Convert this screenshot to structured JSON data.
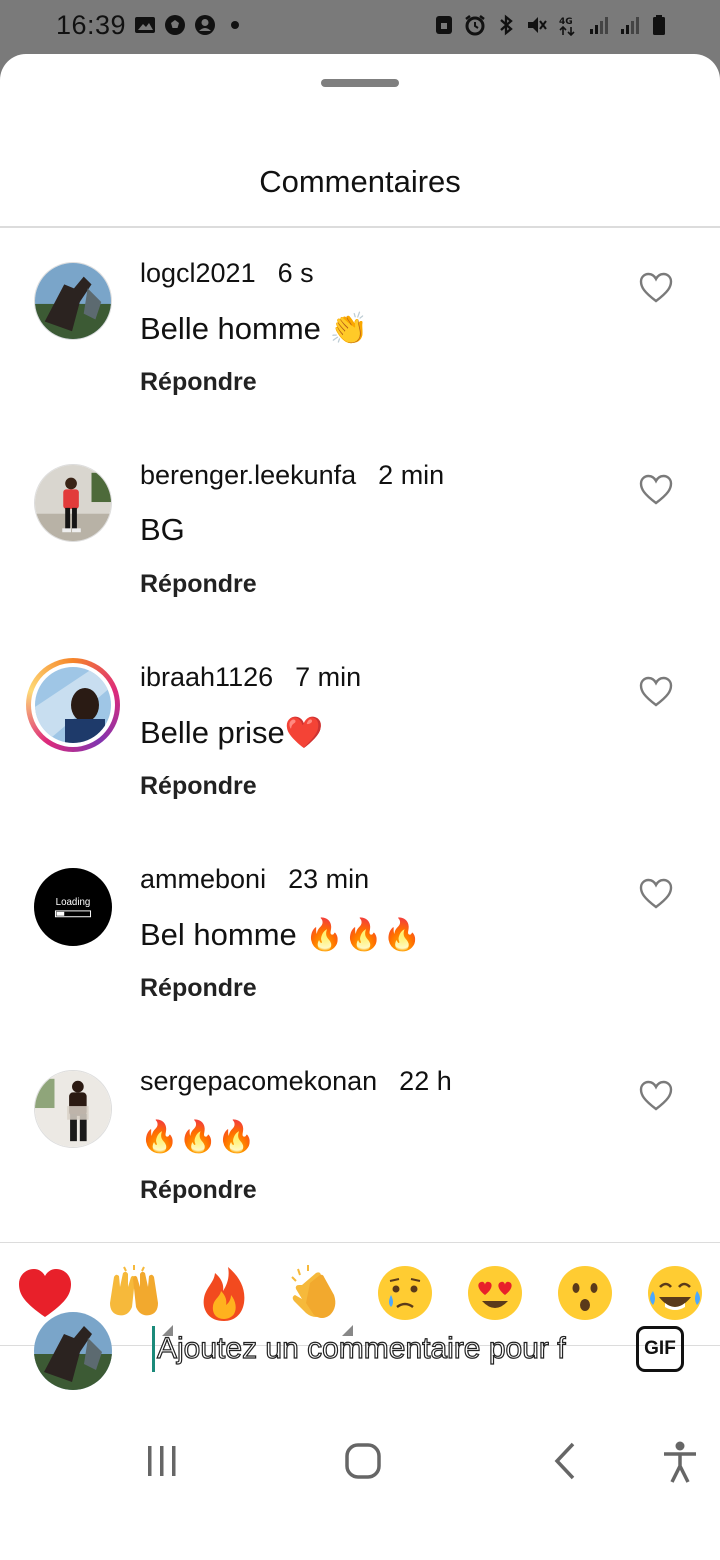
{
  "status_bar": {
    "time": "16:39",
    "left_icons": [
      "image-icon",
      "soccer-ball-icon",
      "account-circle-icon",
      "dot-icon"
    ],
    "right_icons": [
      "vpn-lock-icon",
      "alarm-icon",
      "bluetooth-icon",
      "mute-icon",
      "network-4g-icon",
      "signal-icon",
      "signal-icon",
      "battery-icon"
    ]
  },
  "sheet": {
    "title": "Commentaires"
  },
  "comments": [
    {
      "username": "logcl2021",
      "time": "6 s",
      "text": "Belle homme 👏",
      "reply_label": "Répondre",
      "avatar": "photo-hand"
    },
    {
      "username": "berenger.leekunfa",
      "time": "2 min",
      "text": "BG",
      "reply_label": "Répondre",
      "avatar": "photo-person-red"
    },
    {
      "username": "ibraah1126",
      "time": "7 min",
      "text": "Belle prise❤️",
      "reply_label": "Répondre",
      "avatar": "photo-story-ring"
    },
    {
      "username": "ammeboni",
      "time": "23 min",
      "text": "Bel homme 🔥🔥🔥",
      "reply_label": "Répondre",
      "avatar": "loading-logo"
    },
    {
      "username": "sergepacomekonan",
      "time": "22 h",
      "text": "🔥🔥🔥",
      "reply_label": "Répondre",
      "avatar": "photo-person-dark"
    }
  ],
  "loading_avatar_text": "Loading",
  "emoji_bar": {
    "items": [
      "red-heart",
      "raising-hands",
      "fire",
      "clapping-hands",
      "crying-face",
      "heart-eyes-face",
      "surprised-face",
      "tears-of-joy-face"
    ]
  },
  "composer": {
    "placeholder": "Ajoutez un commentaire pour f",
    "gif_label": "GIF"
  },
  "nav_bar": {
    "items": [
      "recents-icon",
      "home-icon",
      "back-icon",
      "accessibility-icon"
    ]
  },
  "colors": {
    "status_bar_bg": "#7a7a7a",
    "sheet_bg": "#ffffff",
    "divider": "#dcdcdc",
    "cursor": "#1b8a7a"
  }
}
